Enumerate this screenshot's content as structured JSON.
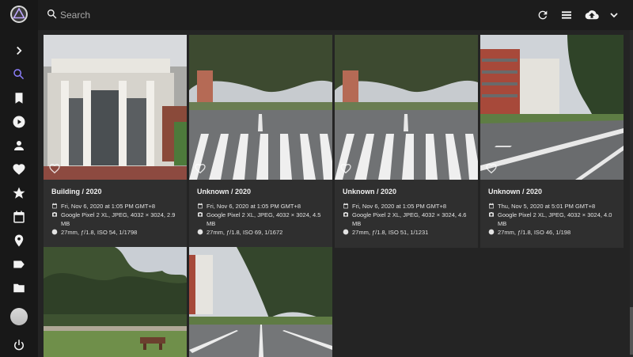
{
  "search": {
    "placeholder": "Search"
  },
  "cards": [
    {
      "title": "Building / 2020",
      "date": "Fri, Nov 6, 2020 at 1:05 PM GMT+8",
      "camera": "Google Pixel 2 XL, JPEG, 4032 × 3024, 2.9 MB",
      "exif": "27mm, ƒ/1.8, ISO 54, 1/1798"
    },
    {
      "title": "Unknown / 2020",
      "date": "Fri, Nov 6, 2020 at 1:05 PM GMT+8",
      "camera": "Google Pixel 2 XL, JPEG, 4032 × 3024, 4.5 MB",
      "exif": "27mm, ƒ/1.8, ISO 69, 1/1672"
    },
    {
      "title": "Unknown / 2020",
      "date": "Fri, Nov 6, 2020 at 1:05 PM GMT+8",
      "camera": "Google Pixel 2 XL, JPEG, 4032 × 3024, 4.6 MB",
      "exif": "27mm, ƒ/1.8, ISO 51, 1/1231"
    },
    {
      "title": "Unknown / 2020",
      "date": "Thu, Nov 5, 2020 at 5:01 PM GMT+8",
      "camera": "Google Pixel 2 XL, JPEG, 4032 × 3024, 4.0 MB",
      "exif": "27mm, ƒ/1.8, ISO 46, 1/198"
    }
  ],
  "sidebar_icons": [
    "expand-icon",
    "search-icon",
    "bookmark-icon",
    "play-icon",
    "person-icon",
    "heart-icon",
    "star-icon",
    "calendar-icon",
    "place-icon",
    "label-icon",
    "folder-icon",
    "avatar",
    "power-icon"
  ],
  "toolbar_icons": [
    "refresh-icon",
    "list-view-icon",
    "upload-icon",
    "chevron-down-icon"
  ],
  "colors": {
    "accent": "#8a7df7",
    "background": "#242424",
    "sidebar": "#181818",
    "card": "#2f2f2f"
  }
}
